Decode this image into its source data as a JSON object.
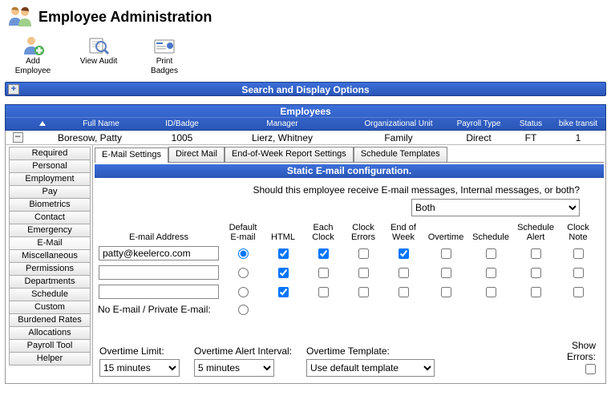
{
  "page_title": "Employee Administration",
  "toolbar": [
    {
      "label": "Add\nEmployee",
      "name": "add-employee-button"
    },
    {
      "label": "View Audit",
      "name": "view-audit-button"
    },
    {
      "label": "Print\nBadges",
      "name": "print-badges-button"
    }
  ],
  "search_bar": "Search and Display Options",
  "employees_title": "Employees",
  "columns": {
    "full_name": "Full Name",
    "id_badge": "ID/Badge",
    "manager": "Manager",
    "org_unit": "Organizational Unit",
    "payroll_type": "Payroll Type",
    "status": "Status",
    "bike_transit": "bike transit"
  },
  "row": {
    "full_name": "Boresow, Patty",
    "id_badge": "1005",
    "manager": "Lierz, Whitney",
    "org_unit": "Family",
    "payroll_type": "Direct",
    "status": "FT",
    "bike_transit": "1"
  },
  "side_tabs": [
    "Required",
    "Personal",
    "Employment",
    "Pay",
    "Biometrics",
    "Contact",
    "Emergency",
    "E-Mail",
    "Miscellaneous",
    "Permissions",
    "Departments",
    "Schedule",
    "Custom",
    "Burdened Rates",
    "Allocations",
    "Payroll Tool",
    "Helper"
  ],
  "side_tab_active": "E-Mail",
  "top_tabs": [
    "E-Mail Settings",
    "Direct Mail",
    "End-of-Week Report Settings",
    "Schedule Templates"
  ],
  "top_tab_active": "E-Mail Settings",
  "section_title": "Static E-mail configuration.",
  "prompt": "Should this employee receive E-mail messages, Internal messages, or both?",
  "receive_select": "Both",
  "grid": {
    "email_header": "E-mail Address",
    "headers": [
      "Default\nE-mail",
      "HTML",
      "Each\nClock",
      "Clock\nErrors",
      "End of\nWeek",
      "Overtime",
      "Schedule",
      "Schedule\nAlert",
      "Clock\nNote"
    ],
    "rows": [
      {
        "email": "patty@keelerco.com",
        "radio": true,
        "checks": [
          true,
          true,
          false,
          true,
          false,
          false,
          false,
          false
        ]
      },
      {
        "email": "",
        "radio": false,
        "checks": [
          true,
          false,
          false,
          false,
          false,
          false,
          false,
          false
        ]
      },
      {
        "email": "",
        "radio": false,
        "checks": [
          true,
          false,
          false,
          false,
          false,
          false,
          false,
          false
        ]
      }
    ],
    "no_email_label": "No E-mail / Private E-mail:"
  },
  "bottom": {
    "overtime_limit_label": "Overtime Limit:",
    "overtime_limit_value": "15 minutes",
    "overtime_alert_label": "Overtime Alert Interval:",
    "overtime_alert_value": "5 minutes",
    "overtime_template_label": "Overtime Template:",
    "overtime_template_value": "Use default template",
    "show_errors_label": "Show\nErrors:"
  }
}
